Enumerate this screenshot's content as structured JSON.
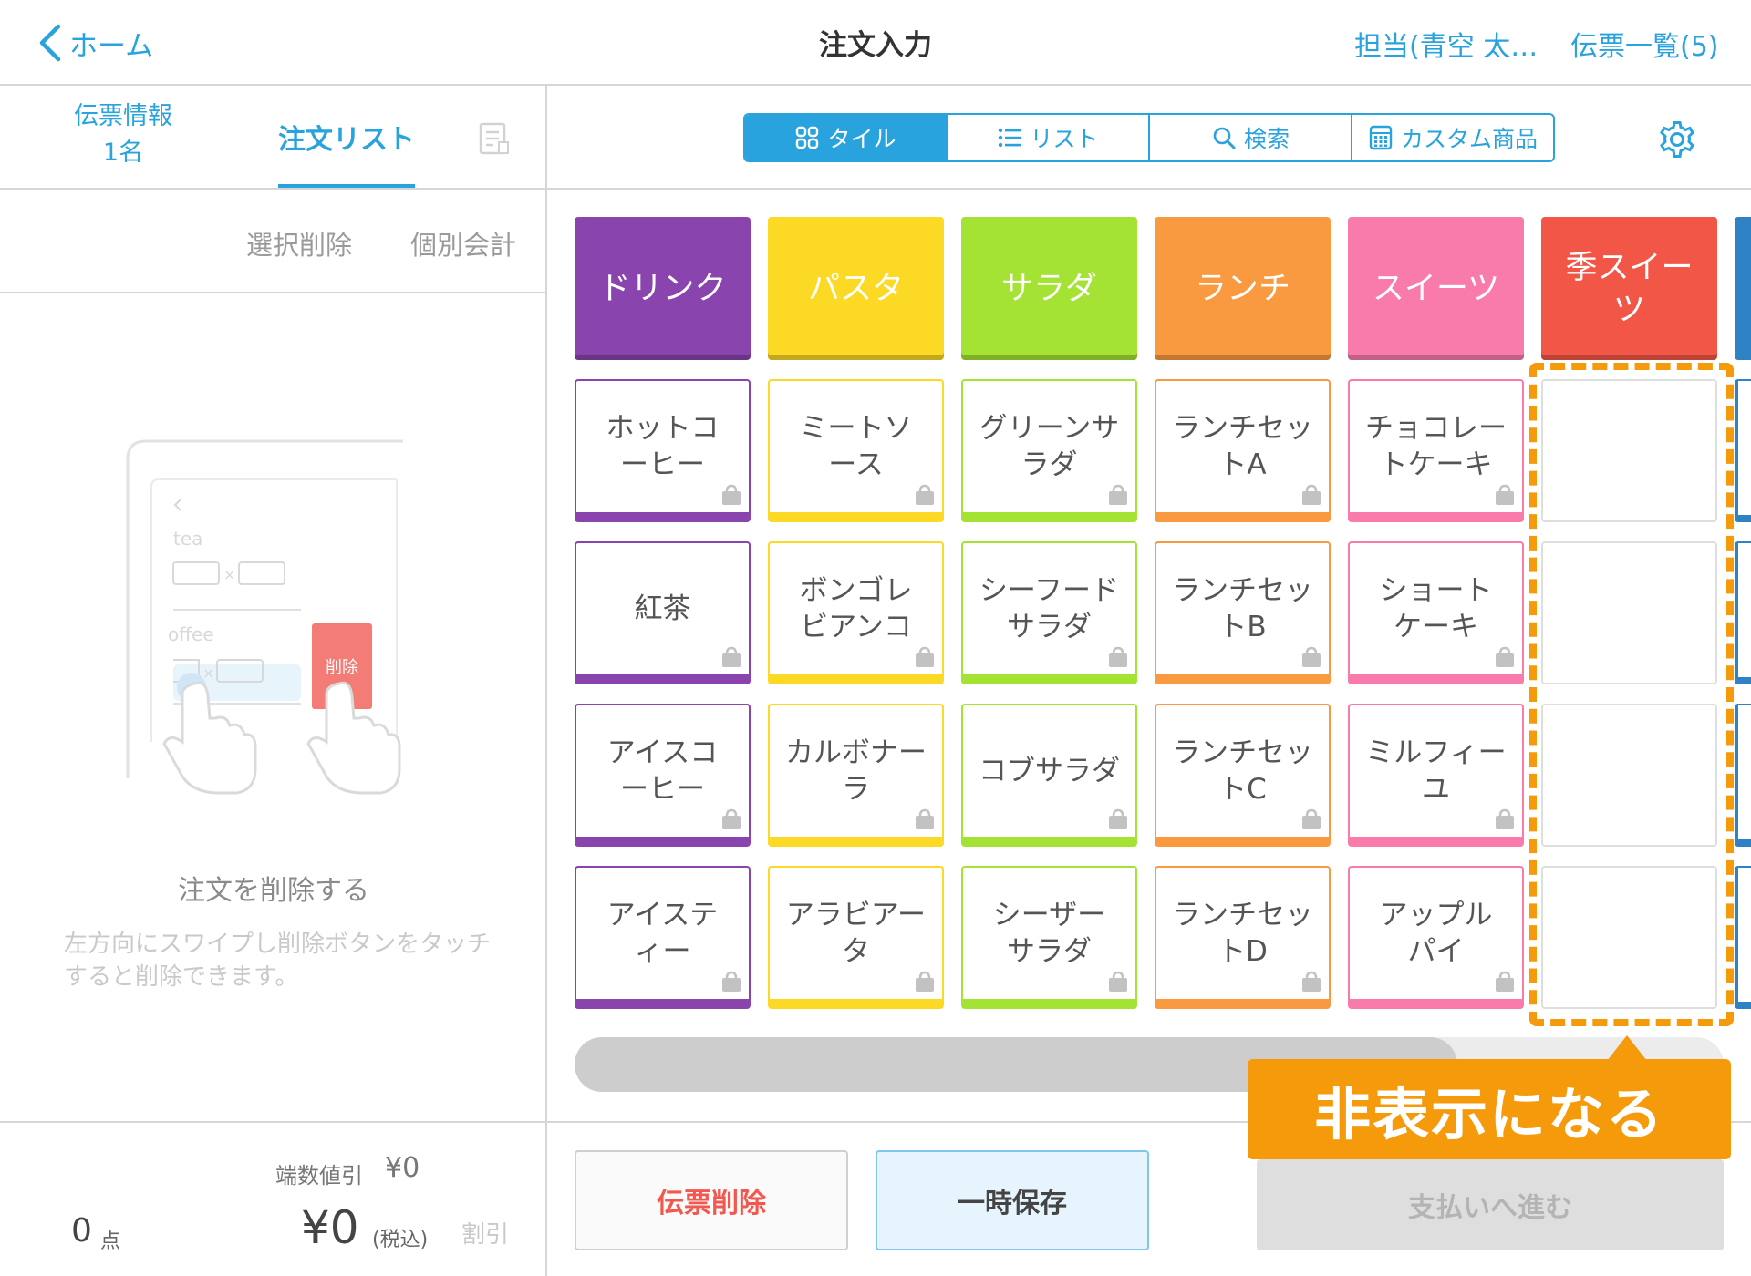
{
  "header": {
    "back_label": "ホーム",
    "title": "注文入力",
    "staff_label": "担当(青空 太…",
    "slip_list_label": "伝票一覧(5)"
  },
  "left_panel": {
    "tabs": {
      "slip_info_line1": "伝票情報",
      "slip_info_line2": "1名",
      "order_list": "注文リスト"
    },
    "actions": {
      "select_delete": "選択削除",
      "split_payment": "個別会計"
    },
    "illustration": {
      "text_tea": "tea",
      "text_coffee": "offee",
      "times1": "×",
      "times2": "×",
      "delete_button": "削除"
    },
    "empty_title": "注文を削除する",
    "empty_description": "左方向にスワイプし削除ボタンをタッチすると削除できます。",
    "footer": {
      "rounding_label": "端数値引",
      "rounding_value": "¥0",
      "quantity": "0",
      "quantity_unit": "点",
      "total": "¥0",
      "tax_note": "(税込)",
      "discount": "割引"
    }
  },
  "view_modes": [
    {
      "label": "タイル",
      "icon": "grid-icon",
      "active": true
    },
    {
      "label": "リスト",
      "icon": "list-icon",
      "active": false
    },
    {
      "label": "検索",
      "icon": "search-icon",
      "active": false
    },
    {
      "label": "カスタム商品",
      "icon": "calculator-icon",
      "active": false
    }
  ],
  "categories": [
    {
      "label": "ドリンク",
      "color": "#8a44ad"
    },
    {
      "label": "パスタ",
      "color": "#fbd925"
    },
    {
      "label": "サラダ",
      "color": "#a4e234"
    },
    {
      "label": "ランチ",
      "color": "#f99a41"
    },
    {
      "label": "スイーツ",
      "color": "#f97bab"
    },
    {
      "label": "季スイーツ",
      "color": "#f25647"
    }
  ],
  "products": {
    "drink": [
      "ホットコーヒー",
      "紅茶",
      "アイスコーヒー",
      "アイスティー"
    ],
    "pasta": [
      "ミートソース",
      "ボンゴレビアンコ",
      "カルボナーラ",
      "アラビアータ"
    ],
    "salad": [
      "グリーンサラダ",
      "シーフードサラダ",
      "コブサラダ",
      "シーザーサラダ"
    ],
    "lunch": [
      "ランチセットA",
      "ランチセットB",
      "ランチセットC",
      "ランチセットD"
    ],
    "sweets": [
      "チョコレートケーキ",
      "ショートケーキ",
      "ミルフィーユ",
      "アップルパイ"
    ]
  },
  "callout": "非表示になる",
  "bottom_buttons": {
    "delete_slip": "伝票削除",
    "hold": "一時保存",
    "proceed_payment": "支払いへ進む"
  },
  "colors": {
    "accent": "#29a3dd",
    "highlight": "#f59a0b",
    "danger": "#f2584e"
  }
}
